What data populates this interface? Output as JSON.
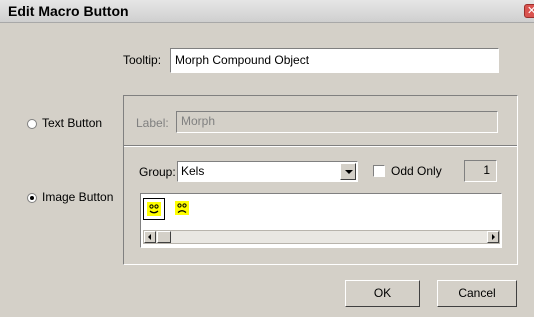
{
  "window": {
    "title": "Edit Macro Button",
    "close_glyph": "✕"
  },
  "tooltip": {
    "label": "Tooltip:",
    "value": "Morph Compound Object"
  },
  "button_type": {
    "text_option": {
      "label": "Text Button",
      "selected": false
    },
    "image_option": {
      "label": "Image Button",
      "selected": true
    }
  },
  "text_settings": {
    "label_caption": "Label:",
    "label_value": "Morph"
  },
  "image_settings": {
    "group_caption": "Group:",
    "group_value": "Kels",
    "odd_only_label": "Odd Only",
    "odd_only_checked": false,
    "count": "1",
    "icons": [
      {
        "name": "smiley-face-icon",
        "selected": true
      },
      {
        "name": "frowning-face-icon",
        "selected": false
      }
    ]
  },
  "buttons": {
    "ok": "OK",
    "cancel": "Cancel"
  },
  "colors": {
    "dialog_bg": "#d4d0c8",
    "icon_face": "#ffff00"
  }
}
